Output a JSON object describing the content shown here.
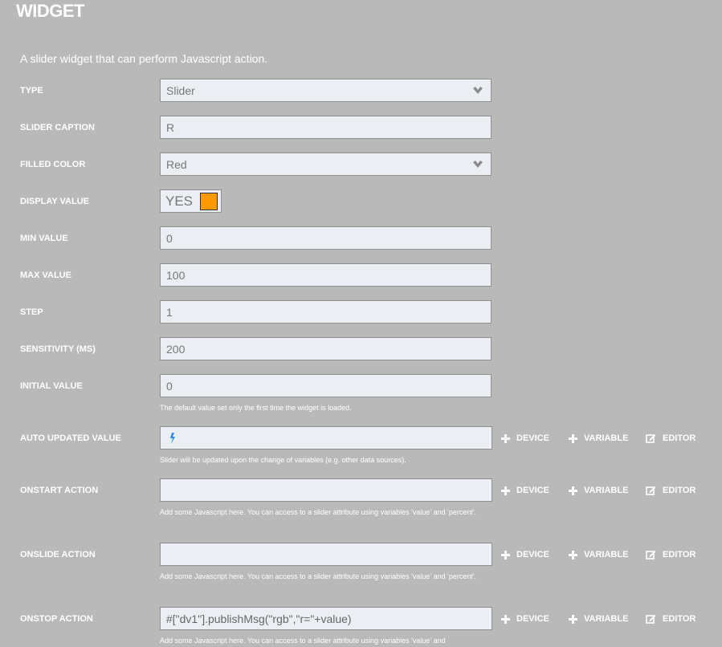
{
  "header": {
    "title": "WIDGET",
    "description": "A slider widget that can perform Javascript action."
  },
  "form": {
    "type": {
      "label": "TYPE",
      "value": "Slider",
      "icon": "chevron-down-icon"
    },
    "slider_caption": {
      "label": "SLIDER CAPTION",
      "value": "R"
    },
    "filled_color": {
      "label": "FILLED COLOR",
      "value": "Red",
      "icon": "chevron-down-icon"
    },
    "display_value": {
      "label": "DISPLAY VALUE",
      "value": "YES",
      "swatch_color": "#ff9900"
    },
    "min_value": {
      "label": "MIN VALUE",
      "value": "0"
    },
    "max_value": {
      "label": "MAX VALUE",
      "value": "100"
    },
    "step": {
      "label": "STEP",
      "value": "1"
    },
    "sensitivity": {
      "label": "SENSITIVITY (MS)",
      "value": "200"
    },
    "initial_value": {
      "label": "INITIAL VALUE",
      "value": "0",
      "help": "The default value set only the first time the widget is loaded."
    },
    "auto_updated_value": {
      "label": "AUTO UPDATED VALUE",
      "value": "",
      "icon": "bolt-icon",
      "help": "Slider will be updated upon the change of variables (e.g. other data sources)."
    },
    "onstart_action": {
      "label": "ONSTART ACTION",
      "value": "",
      "help": "Add some Javascript here. You can access to a slider attribute using variables 'value' and 'percent'."
    },
    "onslide_action": {
      "label": "ONSLIDE ACTION",
      "value": "",
      "help": "Add some Javascript here. You can access to a slider attribute using variables 'value' and 'percent'."
    },
    "onstop_action": {
      "label": "ONSTOP ACTION",
      "value": "#[\"dv1\"].publishMsg(\"rgb\",\"r=\"+value)",
      "help": "Add some Javascript here. You can access to a slider attribute using variables 'value' and"
    }
  },
  "actions": {
    "device": "DEVICE",
    "variable": "VARIABLE",
    "editor": "EDITOR"
  },
  "colors": {
    "background": "#b9b9b9",
    "input_background": "#ebeef3",
    "accent_bolt": "#2a8ae8",
    "swatch": "#ff9900"
  }
}
